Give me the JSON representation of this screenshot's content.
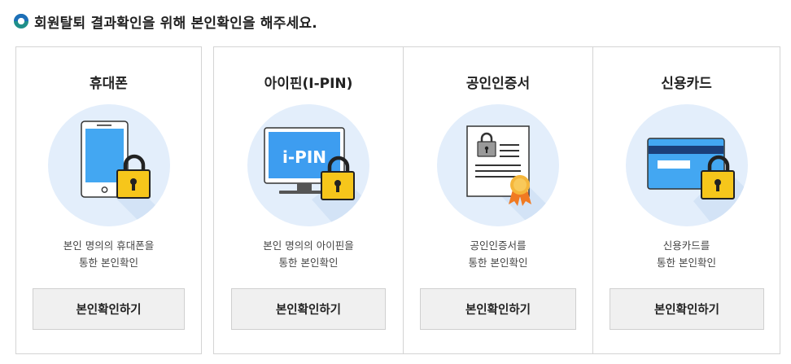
{
  "header": {
    "title": "회원탈퇴 결과확인을 위해 본인확인을 해주세요."
  },
  "cards": [
    {
      "title": "휴대폰",
      "icon": "mobile-phone-lock-icon",
      "desc_line1": "본인 명의의 휴대폰을",
      "desc_line2": "통한 본인확인",
      "button": "본인확인하기"
    },
    {
      "title": "아이핀(I-PIN)",
      "icon": "ipin-monitor-lock-icon",
      "screen_text": "i-PIN",
      "desc_line1": "본인 명의의 아이핀을",
      "desc_line2": "통한 본인확인",
      "button": "본인확인하기"
    },
    {
      "title": "공인인증서",
      "icon": "certificate-lock-icon",
      "desc_line1": "공인인증서를",
      "desc_line2": "통한 본인확인",
      "button": "본인확인하기"
    },
    {
      "title": "신용카드",
      "icon": "credit-card-lock-icon",
      "desc_line1": "신용카드를",
      "desc_line2": "통한 본인확인",
      "button": "본인확인하기"
    }
  ],
  "colors": {
    "circle": "#e3eefb",
    "shadow": "#d3e3f6",
    "lock_yellow": "#f6c61b",
    "screen_blue": "#3d9df0",
    "bullet": "#1f8f8a"
  }
}
